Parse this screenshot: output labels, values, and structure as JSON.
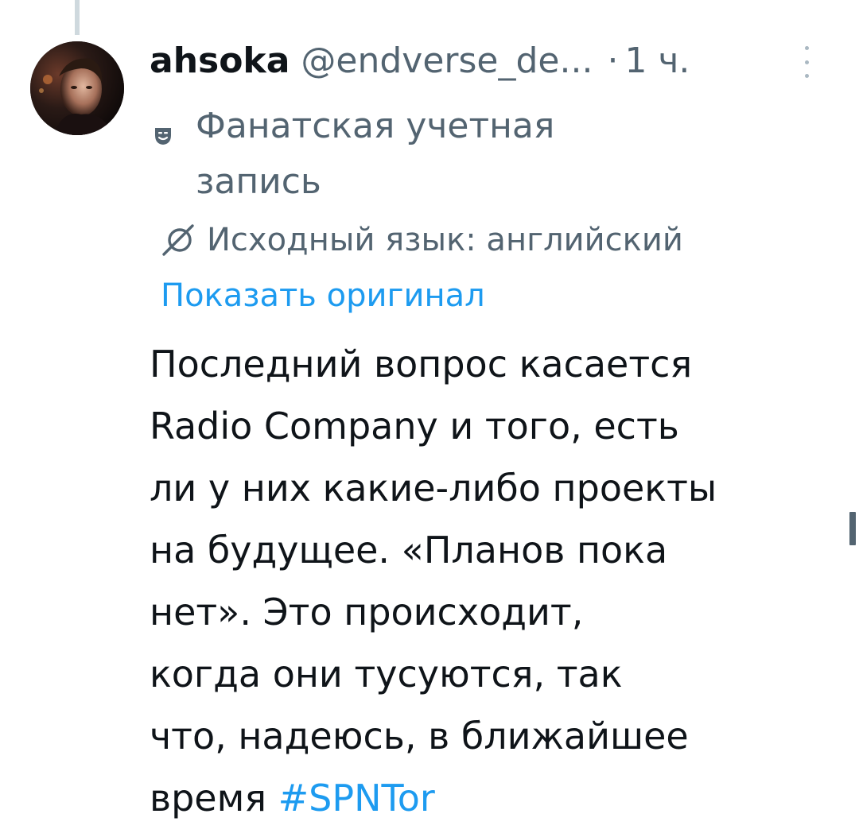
{
  "tweet": {
    "author_name": "ahsoka",
    "author_handle": "@endverse_de...",
    "separator": "·",
    "time": "1 ч.",
    "affiliation_label_line1": "Фанатская учетная",
    "affiliation_label_line2": "запись",
    "affiliation_icon": "theater-masks-icon",
    "source_language": "Исходный язык: английский",
    "show_original": "Показать оригинал",
    "text_lines": [
      "Последний вопрос касается",
      "Radio Company и того, есть",
      "ли у них какие-либо проекты",
      "на будущее. «Планов пока",
      "нет». Это происходит,",
      "когда они тусуются, так",
      "что, надеюсь, в ближайшее"
    ],
    "text_last_prefix": "время ",
    "hashtag": "#SPNTor"
  },
  "colors": {
    "primary_text": "#0f1419",
    "secondary_text": "#536471",
    "link": "#1d9bf0",
    "background": "#ffffff"
  }
}
